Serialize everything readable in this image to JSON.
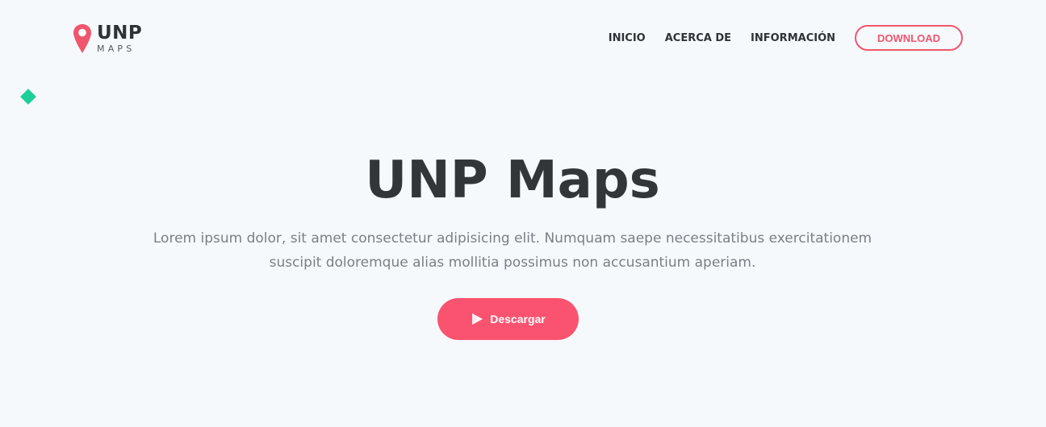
{
  "brand": {
    "name": "UNP",
    "subtitle": "MAPS",
    "icon": "map-pin-icon",
    "color": "#f0566d"
  },
  "nav": {
    "items": [
      {
        "label": "INICIO"
      },
      {
        "label": "ACERCA DE"
      },
      {
        "label": "INFORMACIÓN"
      }
    ],
    "download_label": "DOWNLOAD"
  },
  "hero": {
    "title": "UNP Maps",
    "description": "Lorem ipsum dolor, sit amet consectetur adipisicing elit. Numquam saepe necessitatibus exercitationem suscipit doloremque alias mollitia possimus non accusantium aperiam.",
    "button_label": "Descargar",
    "button_icon": "play-icon"
  },
  "colors": {
    "accent": "#fa5370",
    "decor": "#1fcf9a",
    "background": "#f6f9fc",
    "text_dark": "#333638",
    "text_muted": "#7a7f85"
  }
}
